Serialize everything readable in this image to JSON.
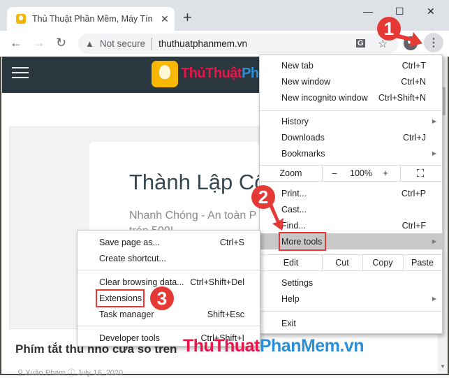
{
  "browser": {
    "tab_title": "Thủ Thuật Phần Mềm, Máy Tính,",
    "tab_close": "✕",
    "new_tab": "+",
    "window_controls": {
      "minimize": "—",
      "maximize": "☐",
      "close": "✕"
    },
    "nav": {
      "back": "←",
      "forward": "→",
      "reload": "↻"
    },
    "security_icon": "▲",
    "security_label": "Not secure",
    "url": "thuthuatphanmem.vn",
    "translate_icon": "G",
    "bookmark_icon": "☆",
    "menu_icon": "⋮"
  },
  "site": {
    "logo_red": "ThủThuật",
    "logo_blue": "Phần",
    "card_title": "Thành Lập Cô",
    "card_subtitle": "Nhanh Chóng - An toàn P",
    "card_subtitle2": "trón 500!",
    "article_title": "Phím tắt thu nhỏ cửa sổ trên",
    "article_meta": "⚲ Xuân Pham  ⓘ July 16, 2020"
  },
  "menu": {
    "items": [
      {
        "label": "New tab",
        "shortcut": "Ctrl+T"
      },
      {
        "label": "New window",
        "shortcut": "Ctrl+N"
      },
      {
        "label": "New incognito window",
        "shortcut": "Ctrl+Shift+N"
      },
      {
        "label": "History",
        "shortcut": ""
      },
      {
        "label": "Downloads",
        "shortcut": "Ctrl+J"
      },
      {
        "label": "Bookmarks",
        "shortcut": ""
      },
      {
        "label": "Print...",
        "shortcut": "Ctrl+P"
      },
      {
        "label": "Cast...",
        "shortcut": ""
      },
      {
        "label": "Find...",
        "shortcut": "Ctrl+F"
      },
      {
        "label": "More tools",
        "shortcut": ""
      },
      {
        "label": "Settings",
        "shortcut": ""
      },
      {
        "label": "Help",
        "shortcut": ""
      },
      {
        "label": "Exit",
        "shortcut": ""
      }
    ],
    "zoom": {
      "label": "Zoom",
      "minus": "–",
      "value": "100%",
      "plus": "+",
      "fullscreen": "⛶"
    },
    "edit": {
      "label": "Edit",
      "cut": "Cut",
      "copy": "Copy",
      "paste": "Paste"
    },
    "submenu_arrow": "▶"
  },
  "submenu": {
    "items": [
      {
        "label": "Save page as...",
        "shortcut": "Ctrl+S"
      },
      {
        "label": "Create shortcut...",
        "shortcut": ""
      },
      {
        "label": "Clear browsing data...",
        "shortcut": "Ctrl+Shift+Del"
      },
      {
        "label": "Extensions",
        "shortcut": ""
      },
      {
        "label": "Task manager",
        "shortcut": "Shift+Esc"
      },
      {
        "label": "Developer tools",
        "shortcut": "Ctrl+Shift+I"
      }
    ]
  },
  "annotations": {
    "step1": "1",
    "step2": "2",
    "step3": "3"
  },
  "watermark": {
    "red": "ThuThuat",
    "blue": "PhanMem.vn"
  },
  "colors": {
    "annotation": "#e53935",
    "logo_red": "#e8144a",
    "logo_blue": "#2d8fd5"
  }
}
